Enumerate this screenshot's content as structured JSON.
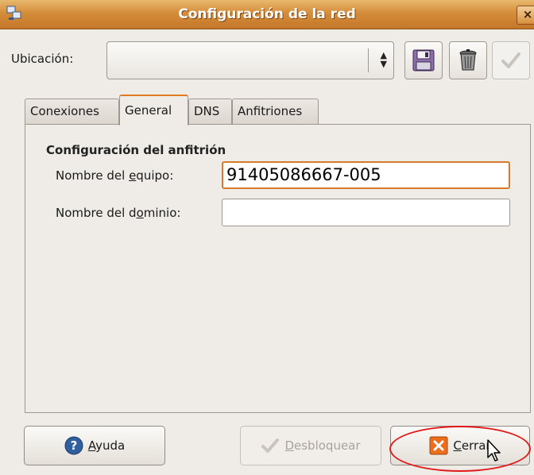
{
  "window": {
    "title": "Configuración de la red",
    "close_glyph": "×",
    "icon": "network-icon"
  },
  "location": {
    "label": "Ubicación:",
    "value": "",
    "save_icon": "floppy-icon",
    "delete_icon": "trash-icon",
    "apply_icon": "check-icon"
  },
  "tabs": [
    {
      "label": "Conexiones",
      "active": false
    },
    {
      "label": "General",
      "active": true
    },
    {
      "label": "DNS",
      "active": false
    },
    {
      "label": "Anfitriones",
      "active": false
    }
  ],
  "general": {
    "section_title": "Configuración del anfitrión",
    "hostname_label_pre": "Nombre del ",
    "hostname_label_u": "e",
    "hostname_label_post": "quipo:",
    "hostname_value": "91405086667-005",
    "domain_label_pre": "Nombre del d",
    "domain_label_u": "o",
    "domain_label_post": "minio:",
    "domain_value": ""
  },
  "buttons": {
    "help_u": "A",
    "help_rest": "yuda",
    "unlock_u": "D",
    "unlock_rest": "esbloquear",
    "close_u": "C",
    "close_rest": "errar"
  },
  "colors": {
    "titlebar": "#d58d3a",
    "accent": "#e07a1f",
    "annotation": "#e11a1a"
  }
}
